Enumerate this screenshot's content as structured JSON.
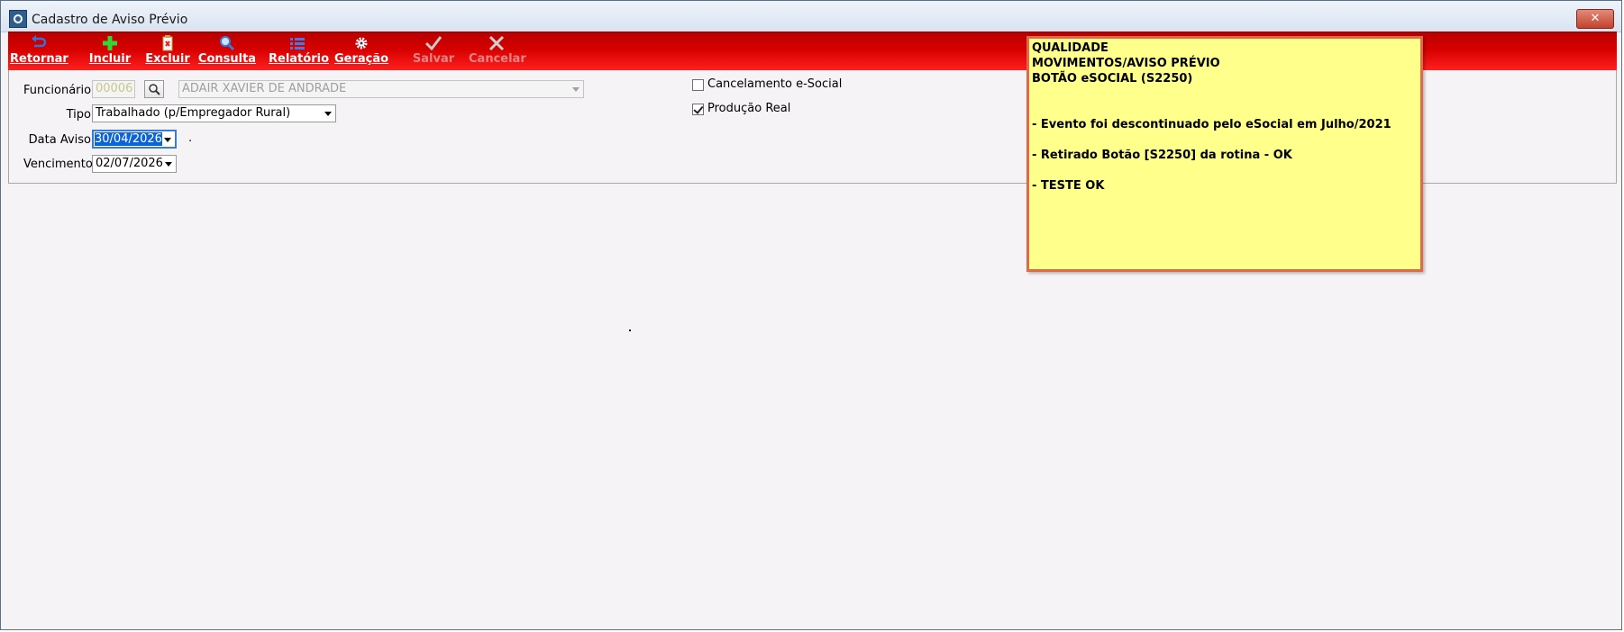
{
  "window": {
    "title": "Cadastro de Aviso Prévio",
    "close_label": "✕"
  },
  "toolbar": {
    "buttons": [
      {
        "id": "retornar",
        "label": "Retornar",
        "enabled": true,
        "icon": "return-arrow-icon"
      },
      {
        "id": "incluir",
        "label": "Incluir",
        "enabled": true,
        "icon": "plus-icon"
      },
      {
        "id": "excluir",
        "label": "Excluir",
        "enabled": true,
        "icon": "delete-clipboard-icon"
      },
      {
        "id": "consulta",
        "label": "Consulta",
        "enabled": true,
        "icon": "magnifier-icon"
      },
      {
        "id": "relatorio",
        "label": "Relatório",
        "enabled": true,
        "icon": "list-icon"
      },
      {
        "id": "geracao",
        "label": "Geração",
        "enabled": true,
        "icon": "gear-icon"
      },
      {
        "id": "salvar",
        "label": "Salvar",
        "enabled": false,
        "icon": "check-icon"
      },
      {
        "id": "cancelar",
        "label": "Cancelar",
        "enabled": false,
        "icon": "x-icon"
      }
    ]
  },
  "form": {
    "funcionario": {
      "label": "Funcionário",
      "code": "00006",
      "name": "ADAIR XAVIER DE ANDRADE"
    },
    "tipo": {
      "label": "Tipo",
      "value": "Trabalhado (p/Empregador Rural)"
    },
    "data_aviso": {
      "label": "Data Aviso",
      "value": "30/04/2026",
      "trailing": "."
    },
    "vencimento": {
      "label": "Vencimento",
      "value": "02/07/2026"
    },
    "cancelamento_esocial": {
      "label": "Cancelamento e-Social",
      "checked": false
    },
    "producao_real": {
      "label": "Produção Real",
      "checked": true
    }
  },
  "note": {
    "lines": [
      "QUALIDADE",
      "MOVIMENTOS/AVISO PRÉVIO",
      "BOTÃO eSOCIAL (S2250)",
      "",
      "",
      "- Evento foi descontinuado pelo eSocial em Julho/2021",
      "",
      "- Retirado Botão [S2250] da rotina - OK",
      "",
      "- TESTE OK"
    ]
  },
  "colors": {
    "toolbar": "#d70000",
    "note_bg": "#ffff8c",
    "note_border": "#de6a4a",
    "selection": "#0a64d8"
  }
}
